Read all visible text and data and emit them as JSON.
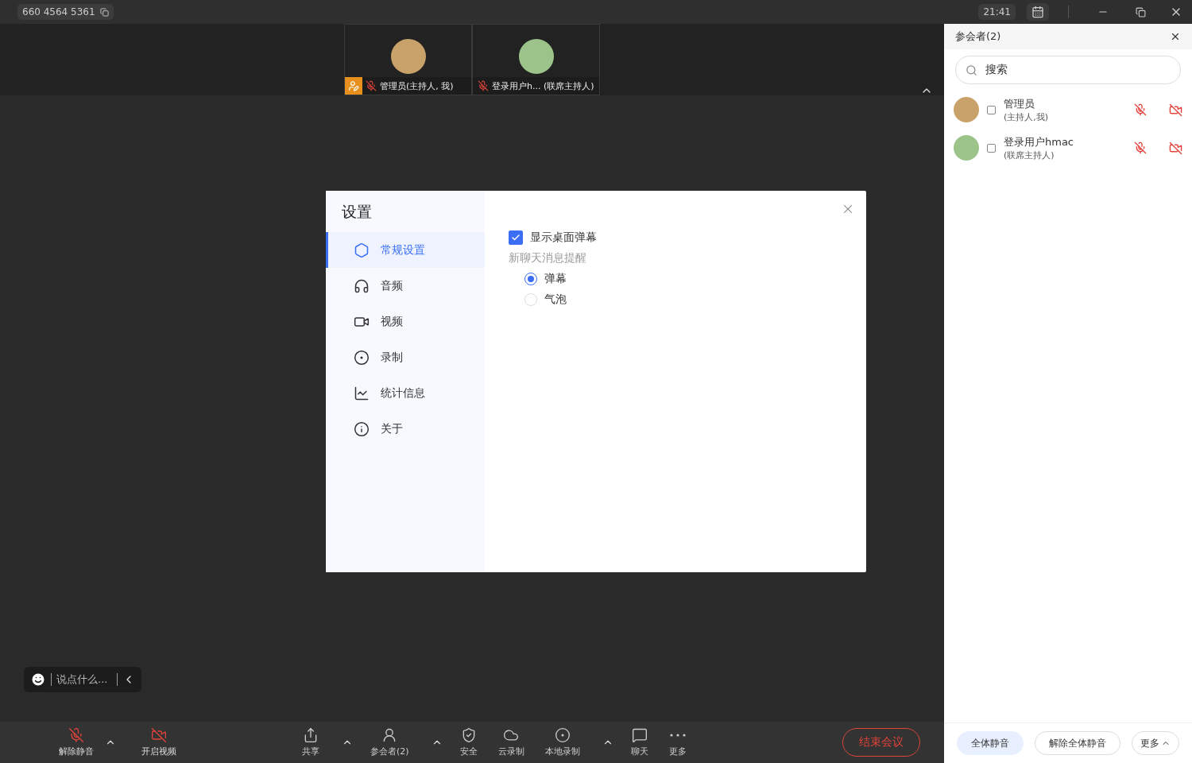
{
  "title_bar": {
    "meeting_id": "660 4564 5361",
    "time": "21:41"
  },
  "thumbnails": [
    {
      "name": "管理员(主持人, 我)",
      "host": true,
      "muted": true
    },
    {
      "name": "登录用户h... (联席主持人)",
      "host": false,
      "muted": true
    }
  ],
  "chat_input": {
    "placeholder": "说点什么..."
  },
  "toolbar": [
    {
      "label": "解除静音",
      "kind": "danger",
      "has_menu": true
    },
    {
      "label": "开启视频",
      "kind": "danger",
      "has_menu": false
    },
    {
      "label": "共享",
      "kind": "normal",
      "has_menu": true
    },
    {
      "label": "参会者(2)",
      "kind": "normal",
      "has_menu": true
    },
    {
      "label": "安全",
      "kind": "normal",
      "has_menu": false
    },
    {
      "label": "云录制",
      "kind": "normal",
      "has_menu": false
    },
    {
      "label": "本地录制",
      "kind": "normal",
      "has_menu": true
    },
    {
      "label": "聊天",
      "kind": "normal",
      "has_menu": false
    },
    {
      "label": "更多",
      "kind": "normal",
      "has_menu": false
    }
  ],
  "end_button": "结束会议",
  "settings": {
    "title": "设置",
    "nav": [
      {
        "label": "常规设置",
        "selected": true
      },
      {
        "label": "音频",
        "selected": false
      },
      {
        "label": "视频",
        "selected": false
      },
      {
        "label": "录制",
        "selected": false
      },
      {
        "label": "统计信息",
        "selected": false
      },
      {
        "label": "关于",
        "selected": false
      }
    ],
    "show_barrage": {
      "label": "显示桌面弹幕",
      "checked": true
    },
    "notify_label": "新聊天消息提醒",
    "notify_options": [
      {
        "label": "弹幕",
        "selected": true
      },
      {
        "label": "气泡",
        "selected": false
      }
    ]
  },
  "participants_panel": {
    "title": "参会者(2)",
    "search_placeholder": "搜索",
    "people": [
      {
        "name": "管理员",
        "role": "(主持人,我)",
        "checked": false,
        "muted": true,
        "video_off": true
      },
      {
        "name": "登录用户hmac",
        "role": "(联席主持人)",
        "checked": false,
        "muted": true,
        "video_off": true
      }
    ],
    "buttons": [
      {
        "label": "全体静音",
        "kind": "primary"
      },
      {
        "label": "解除全体静音",
        "kind": "outline"
      },
      {
        "label": "更多",
        "kind": "menu"
      }
    ]
  }
}
